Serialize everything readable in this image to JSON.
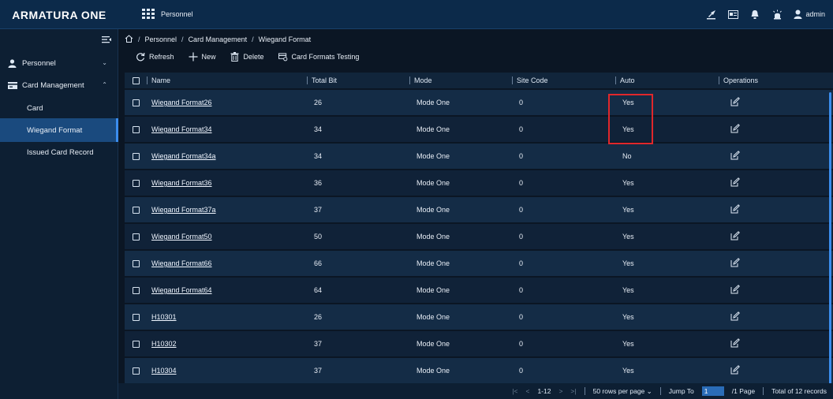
{
  "app": {
    "logo": "ARMATURA ONE",
    "module": "Personnel",
    "user": "admin"
  },
  "topbar_icons": [
    "pin-icon",
    "id-card-icon",
    "bell-icon",
    "alarm-icon",
    "user-icon"
  ],
  "sidebar": {
    "groups": [
      {
        "label": "Personnel",
        "icon": "person-icon",
        "chevron": "⌄"
      },
      {
        "label": "Card Management",
        "icon": "card-icon",
        "chevron": "⌃"
      }
    ],
    "items": [
      {
        "label": "Card"
      },
      {
        "label": "Wiegand Format"
      },
      {
        "label": "Issued Card Record"
      }
    ]
  },
  "breadcrumb": [
    "Personnel",
    "Card Management",
    "Wiegand Format"
  ],
  "toolbar": {
    "refresh": "Refresh",
    "new": "New",
    "delete": "Delete",
    "testing": "Card Formats Testing"
  },
  "table": {
    "headers": [
      "Name",
      "Total Bit",
      "Mode",
      "Site Code",
      "Auto",
      "Operations"
    ],
    "rows": [
      {
        "name": "Wiegand Format26",
        "total": "26",
        "mode": "Mode One",
        "site": "0",
        "auto": "Yes"
      },
      {
        "name": "Wiegand Format34",
        "total": "34",
        "mode": "Mode One",
        "site": "0",
        "auto": "Yes"
      },
      {
        "name": "Wiegand Format34a",
        "total": "34",
        "mode": "Mode One",
        "site": "0",
        "auto": "No"
      },
      {
        "name": "Wiegand Format36",
        "total": "36",
        "mode": "Mode One",
        "site": "0",
        "auto": "Yes"
      },
      {
        "name": "Wiegand Format37a",
        "total": "37",
        "mode": "Mode One",
        "site": "0",
        "auto": "Yes"
      },
      {
        "name": "Wiegand Format50",
        "total": "50",
        "mode": "Mode One",
        "site": "0",
        "auto": "Yes"
      },
      {
        "name": "Wiegand Format66",
        "total": "66",
        "mode": "Mode One",
        "site": "0",
        "auto": "Yes"
      },
      {
        "name": "Wiegand Format64",
        "total": "64",
        "mode": "Mode One",
        "site": "0",
        "auto": "Yes"
      },
      {
        "name": "H10301",
        "total": "26",
        "mode": "Mode One",
        "site": "0",
        "auto": "Yes"
      },
      {
        "name": "H10302",
        "total": "37",
        "mode": "Mode One",
        "site": "0",
        "auto": "Yes"
      },
      {
        "name": "H10304",
        "total": "37",
        "mode": "Mode One",
        "site": "0",
        "auto": "Yes"
      }
    ]
  },
  "pager": {
    "first": "|<",
    "prev": "<",
    "range": "1-12",
    "next": ">",
    "last": ">|",
    "rows_per_page": "50 rows per page",
    "jump_label": "Jump To",
    "jump_value": "1",
    "page_total": "/1 Page",
    "total_records": "Total of 12 records"
  },
  "colors": {
    "accent": "#3b8ded",
    "highlight": "#e0272b",
    "active_nav": "#1a4a7e"
  }
}
